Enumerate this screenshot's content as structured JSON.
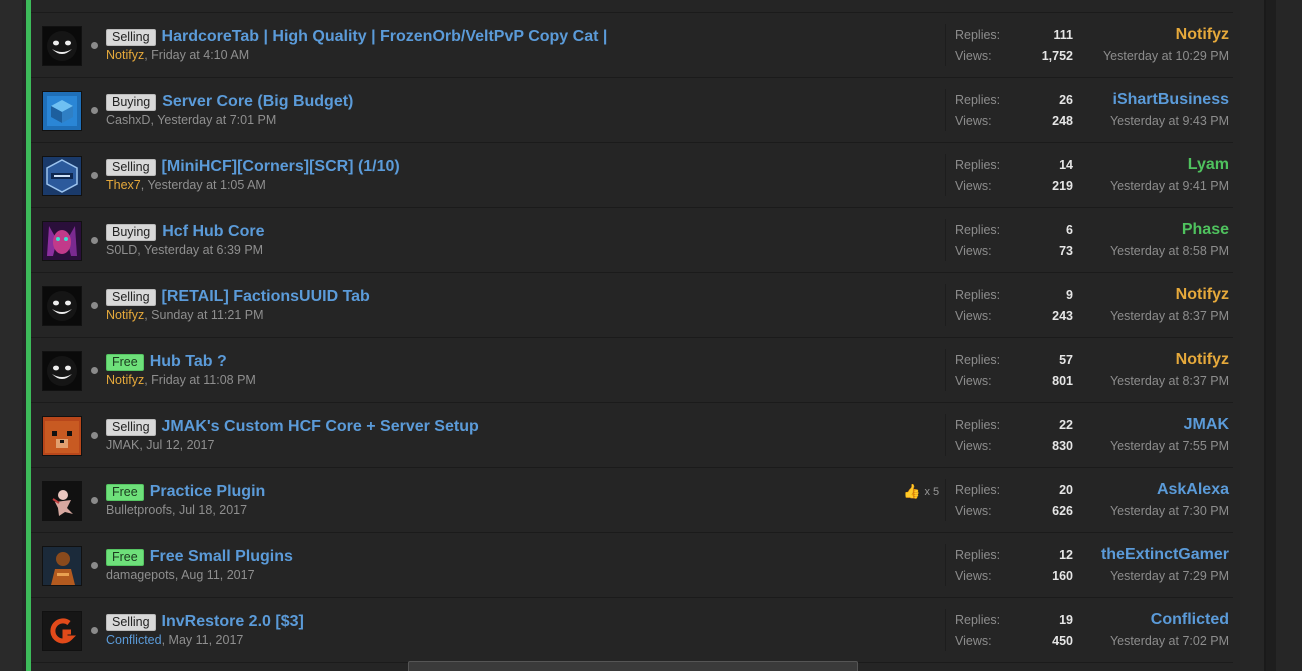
{
  "colors": {
    "accent_bar": "#3dbb5a",
    "link_blue": "#5b9bd9",
    "username_orange": "#e6a93b",
    "username_green": "#4fc25e",
    "prefix_gray": "#d8d8d8",
    "prefix_green": "#6ee07a"
  },
  "labels": {
    "replies": "Replies:",
    "views": "Views:"
  },
  "threads": [
    {
      "prefix": "Selling",
      "prefix_style": "gray",
      "title": "HardcoreTab | High Quality | FrozenOrb/VeltPvP Copy Cat |",
      "starter": "Notifyz",
      "starter_color": "#e6a93b",
      "date": "Friday at 4:10 AM",
      "replies": "111",
      "views": "1,752",
      "last_user": "Notifyz",
      "last_user_color": "#e6a93b",
      "last_time": "Yesterday at 10:29 PM",
      "avatar_icon": "smiley-face-avatar-icon",
      "likes": null
    },
    {
      "prefix": "Buying",
      "prefix_style": "gray",
      "title": "Server Core (Big Budget)",
      "starter": "CashxD",
      "starter_color": "#8f8f8f",
      "date": "Yesterday at 7:01 PM",
      "replies": "26",
      "views": "248",
      "last_user": "iShartBusiness",
      "last_user_color": "#5b9bd9",
      "last_time": "Yesterday at 9:43 PM",
      "avatar_icon": "blue-cube-avatar-icon",
      "likes": null
    },
    {
      "prefix": "Selling",
      "prefix_style": "gray",
      "title": "[MiniHCF][Corners][SCR] (1/10)",
      "starter": "Thex7",
      "starter_color": "#e6a93b",
      "date": "Yesterday at 1:05 AM",
      "replies": "14",
      "views": "219",
      "last_user": "Lyam",
      "last_user_color": "#4fc25e",
      "last_time": "Yesterday at 9:41 PM",
      "avatar_icon": "blue-badge-avatar-icon",
      "likes": null
    },
    {
      "prefix": "Buying",
      "prefix_style": "gray",
      "title": "Hcf Hub Core",
      "starter": "S0LD",
      "starter_color": "#8f8f8f",
      "date": "Yesterday at 6:39 PM",
      "replies": "6",
      "views": "73",
      "last_user": "Phase",
      "last_user_color": "#4fc25e",
      "last_time": "Yesterday at 8:58 PM",
      "avatar_icon": "purple-creature-avatar-icon",
      "likes": null
    },
    {
      "prefix": "Selling",
      "prefix_style": "gray",
      "title": "[RETAIL] FactionsUUID Tab",
      "starter": "Notifyz",
      "starter_color": "#e6a93b",
      "date": "Sunday at 11:21 PM",
      "replies": "9",
      "views": "243",
      "last_user": "Notifyz",
      "last_user_color": "#e6a93b",
      "last_time": "Yesterday at 8:37 PM",
      "avatar_icon": "smiley-face-avatar-icon",
      "likes": null
    },
    {
      "prefix": "Free",
      "prefix_style": "green",
      "title": "Hub Tab ?",
      "starter": "Notifyz",
      "starter_color": "#e6a93b",
      "date": "Friday at 11:08 PM",
      "replies": "57",
      "views": "801",
      "last_user": "Notifyz",
      "last_user_color": "#e6a93b",
      "last_time": "Yesterday at 8:37 PM",
      "avatar_icon": "smiley-face-avatar-icon",
      "likes": null
    },
    {
      "prefix": "Selling",
      "prefix_style": "gray",
      "title": "JMAK's Custom HCF Core + Server Setup",
      "starter": "JMAK",
      "starter_color": "#8f8f8f",
      "date": "Jul 12, 2017",
      "replies": "22",
      "views": "830",
      "last_user": "JMAK",
      "last_user_color": "#5b9bd9",
      "last_time": "Yesterday at 7:55 PM",
      "avatar_icon": "brown-bear-avatar-icon",
      "likes": null
    },
    {
      "prefix": "Free",
      "prefix_style": "green",
      "title": "Practice Plugin",
      "starter": "Bulletproofs",
      "starter_color": "#8f8f8f",
      "date": "Jul 18, 2017",
      "replies": "20",
      "views": "626",
      "last_user": "AskAlexa",
      "last_user_color": "#5b9bd9",
      "last_time": "Yesterday at 7:30 PM",
      "avatar_icon": "pink-figure-avatar-icon",
      "likes": "x 5"
    },
    {
      "prefix": "Free",
      "prefix_style": "green",
      "title": "Free Small Plugins",
      "starter": "damagepots",
      "starter_color": "#8f8f8f",
      "date": "Aug 11, 2017",
      "replies": "12",
      "views": "160",
      "last_user": "theExtinctGamer",
      "last_user_color": "#5b9bd9",
      "last_time": "Yesterday at 7:29 PM",
      "avatar_icon": "orange-character-avatar-icon",
      "likes": null
    },
    {
      "prefix": "Selling",
      "prefix_style": "gray",
      "title": "InvRestore 2.0 [$3]",
      "starter": "Conflicted",
      "starter_color": "#5b9bd9",
      "date": "May 11, 2017",
      "replies": "19",
      "views": "450",
      "last_user": "Conflicted",
      "last_user_color": "#5b9bd9",
      "last_time": "Yesterday at 7:02 PM",
      "avatar_icon": "orange-logo-avatar-icon",
      "likes": null
    }
  ]
}
